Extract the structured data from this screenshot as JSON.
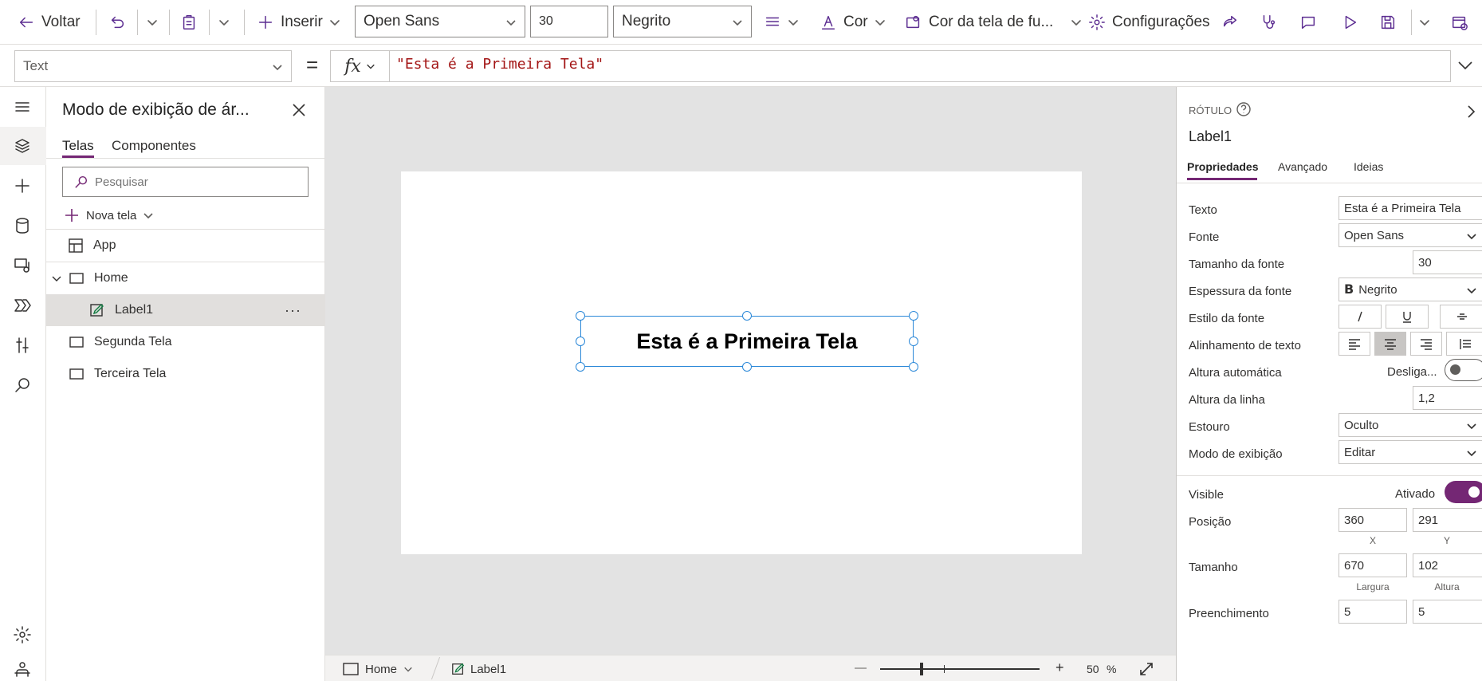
{
  "toolbar": {
    "back_label": "Voltar",
    "insert_label": "Inserir",
    "font_value": "Open Sans",
    "size_value": "30",
    "weight_value": "Negrito",
    "color_label": "Cor",
    "bgcolor_label": "Cor da tela de fu...",
    "settings_label": "Configurações"
  },
  "formula_bar": {
    "property": "Text",
    "equals": "=",
    "fx": "fx",
    "formula": "\"Esta é a Primeira Tela\""
  },
  "tree": {
    "title": "Modo de exibição de ár...",
    "tabs": [
      {
        "label": "Telas"
      },
      {
        "label": "Componentes"
      }
    ],
    "search_placeholder": "Pesquisar",
    "new_screen_label": "Nova tela",
    "items": [
      {
        "label": "App"
      },
      {
        "label": "Home"
      },
      {
        "label": "Label1"
      },
      {
        "label": "Segunda Tela"
      },
      {
        "label": "Terceira Tela"
      }
    ],
    "more": "···"
  },
  "canvas": {
    "label_text": "Esta é a Primeira Tela"
  },
  "status": {
    "screen": "Home",
    "control": "Label1",
    "zoom_value": "50",
    "zoom_unit": "%",
    "zoom_minus": "—",
    "zoom_plus": "+"
  },
  "props": {
    "type_label": "RÓTULO",
    "control_name": "Label1",
    "tabs": [
      {
        "label": "Propriedades"
      },
      {
        "label": "Avançado"
      },
      {
        "label": "Ideias"
      }
    ],
    "rows": {
      "text_label": "Texto",
      "text_value": "Esta é a Primeira Tela",
      "font_label": "Fonte",
      "font_value": "Open Sans",
      "size_label": "Tamanho da fonte",
      "size_value": "30",
      "weight_label": "Espessura da fonte",
      "weight_value": "Negrito",
      "style_label": "Estilo da fonte",
      "align_label": "Alinhamento de texto",
      "autoheight_label": "Altura automática",
      "autoheight_value": "Desliga...",
      "lineheight_label": "Altura da linha",
      "lineheight_value": "1,2",
      "overflow_label": "Estouro",
      "overflow_value": "Oculto",
      "displaymode_label": "Modo de exibição",
      "displaymode_value": "Editar",
      "visible_label": "Visible",
      "visible_value": "Ativado",
      "position_label": "Posição",
      "pos_x": "360",
      "pos_y": "291",
      "pos_x_label": "X",
      "pos_y_label": "Y",
      "size2_label": "Tamanho",
      "width": "670",
      "height": "102",
      "width_label": "Largura",
      "height_label": "Altura",
      "padding_label": "Preenchimento",
      "pad_1": "5",
      "pad_2": "5"
    }
  },
  "colors": {
    "accent": "#742774",
    "selection": "#2b88d8",
    "formula_string": "#a31515"
  }
}
